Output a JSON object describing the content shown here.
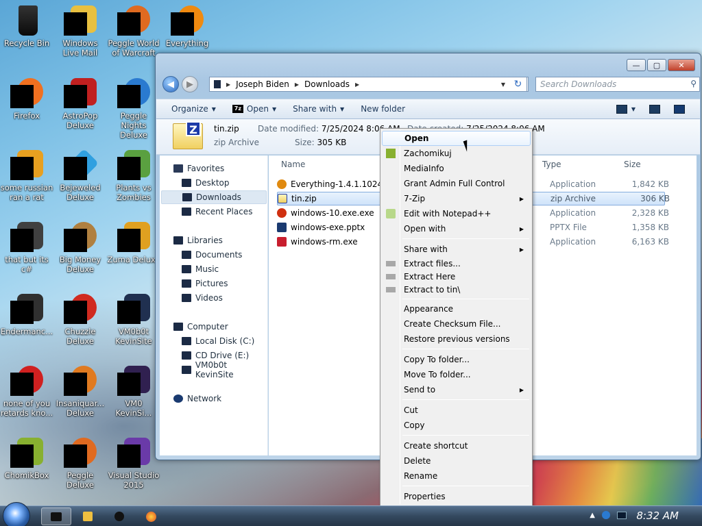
{
  "desktop": {
    "icons": [
      {
        "label": "Recycle Bin"
      },
      {
        "label": "Windows Live Mail"
      },
      {
        "label": "Peggle World of Warcraft"
      },
      {
        "label": "Everything"
      },
      {
        "label": "Firefox"
      },
      {
        "label": "AstroPop Deluxe"
      },
      {
        "label": "Peggle Nights Deluxe"
      },
      {
        "label": "some russian ran a rat"
      },
      {
        "label": "Bejeweled Deluxe"
      },
      {
        "label": "Plants vs Zombies"
      },
      {
        "label": "that but its c#"
      },
      {
        "label": "Big Money Deluxe"
      },
      {
        "label": "Zuma Deluxe"
      },
      {
        "label": "Endermanc..."
      },
      {
        "label": "Chuzzle Deluxe"
      },
      {
        "label": "VM0b0t KevinSite"
      },
      {
        "label": "none of you retards kno..."
      },
      {
        "label": "Insaniquar... Deluxe"
      },
      {
        "label": "VM0 KevinSi..."
      },
      {
        "label": "ChomikBox"
      },
      {
        "label": "Peggle Deluxe"
      },
      {
        "label": "Visual Studio 2015"
      }
    ]
  },
  "window": {
    "controls": {
      "minimize": "—",
      "maximize": "▢",
      "close": "✕"
    },
    "breadcrumb": [
      "Joseph Biden",
      "Downloads"
    ],
    "search_placeholder": "Search Downloads",
    "toolbar": {
      "organize": "Organize",
      "open": "Open",
      "share_with": "Share with",
      "new_folder": "New folder"
    },
    "details": {
      "name": "tin.zip",
      "type": "zip Archive",
      "date_modified_label": "Date modified:",
      "date_modified": "7/25/2024 8:06 AM",
      "size_label": "Size:",
      "size": "305 KB",
      "date_created_label": "Date created:",
      "date_created": "7/25/2024 8:06 AM"
    },
    "nav": {
      "favorites": "Favorites",
      "desktop": "Desktop",
      "downloads": "Downloads",
      "recent_places": "Recent Places",
      "libraries": "Libraries",
      "documents": "Documents",
      "music": "Music",
      "pictures": "Pictures",
      "videos": "Videos",
      "computer": "Computer",
      "local_disk": "Local Disk (C:)",
      "cd_drive": "CD Drive (E:)",
      "vm_drive": "VM0b0t KevinSite",
      "network": "Network"
    },
    "columns": {
      "name": "Name",
      "type": "Type",
      "size": "Size"
    },
    "files": [
      {
        "name": "Everything-1.4.1.1024.x64",
        "type": "Application",
        "size": "1,842 KB",
        "color": "#e08a10"
      },
      {
        "name": "tin.zip",
        "type": "zip Archive",
        "size": "306 KB",
        "color": "#1c3aa8"
      },
      {
        "name": "windows-10.exe.exe",
        "type": "Application",
        "size": "2,328 KB",
        "color": "#d03010"
      },
      {
        "name": "windows-exe.pptx",
        "type": "PPTX File",
        "size": "1,358 KB",
        "color": "#1a3a70"
      },
      {
        "name": "windows-rm.exe",
        "type": "Application",
        "size": "6,163 KB",
        "color": "#c81e2e"
      }
    ]
  },
  "context_menu": {
    "open": "Open",
    "zachomikuj": "Zachomikuj",
    "mediainfo": "MediaInfo",
    "grant_admin": "Grant Admin Full Control",
    "seven_zip": "7-Zip",
    "edit_notepad": "Edit with Notepad++",
    "open_with": "Open with",
    "share_with": "Share with",
    "extract_files": "Extract files...",
    "extract_here": "Extract Here",
    "extract_to": "Extract to tin\\",
    "appearance": "Appearance",
    "checksum": "Create Checksum File...",
    "restore": "Restore previous versions",
    "copy_to": "Copy To folder...",
    "move_to": "Move To folder...",
    "send_to": "Send to",
    "cut": "Cut",
    "copy": "Copy",
    "create_shortcut": "Create shortcut",
    "delete": "Delete",
    "rename": "Rename",
    "properties": "Properties"
  },
  "taskbar": {
    "clock": "8:32 AM"
  }
}
